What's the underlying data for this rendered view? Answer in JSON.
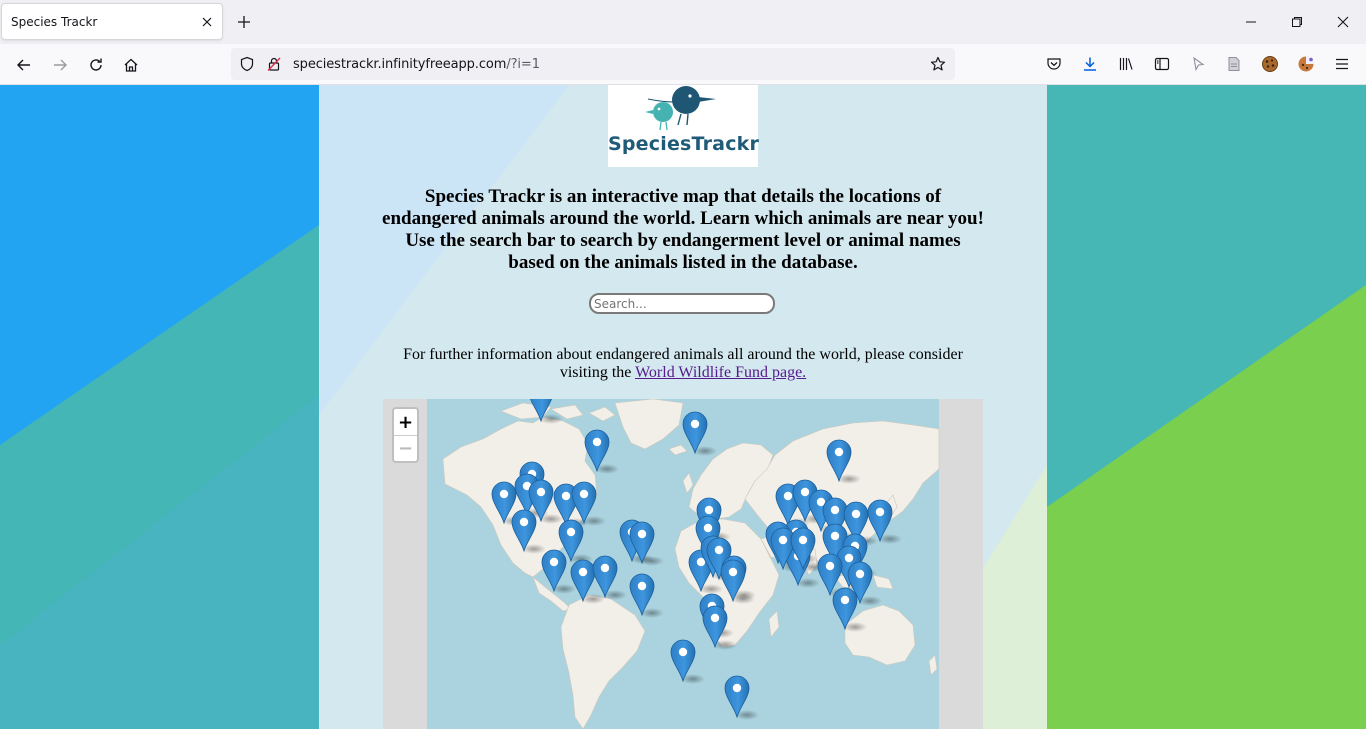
{
  "browser": {
    "tab_title": "Species Trackr",
    "url_domain": "speciestrackr.infinityfreeapp.com",
    "url_path": "/?i=1"
  },
  "page": {
    "logo_text": "SpeciesTrackr",
    "intro": "Species Trackr is an interactive map that details the locations of endangered animals around the world. Learn which animals are near you! Use the search bar to search by endangerment level or animal names based on the animals listed in the database.",
    "search_placeholder": "Search...",
    "info_text": "For further information about endangered animals all around the world, please consider visiting the",
    "info_link": "World Wildlife Fund page.",
    "zoom_in": "+",
    "zoom_out": "−"
  },
  "colors": {
    "accent_blue": "#2a81cb",
    "ocean": "#aad3df",
    "land": "#f2efe9"
  }
}
